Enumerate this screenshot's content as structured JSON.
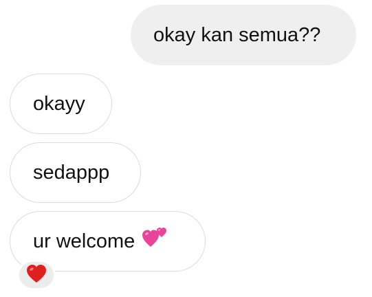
{
  "messages": [
    {
      "direction": "sent",
      "text": "okay kan semua??"
    },
    {
      "direction": "received",
      "text": "okayy"
    },
    {
      "direction": "received",
      "text": "sedappp"
    },
    {
      "direction": "received",
      "text": "ur welcome",
      "emoji": "two-hearts-icon"
    }
  ],
  "reactions": [
    {
      "message_index": 3,
      "emoji": "red-heart-icon"
    }
  ],
  "colors": {
    "sent_bubble_bg": "#efefef",
    "received_bubble_border": "#dbdbdb",
    "reaction_bg": "#ececec",
    "heart_red": "#e0201c",
    "heart_pink": "#e8449a"
  }
}
